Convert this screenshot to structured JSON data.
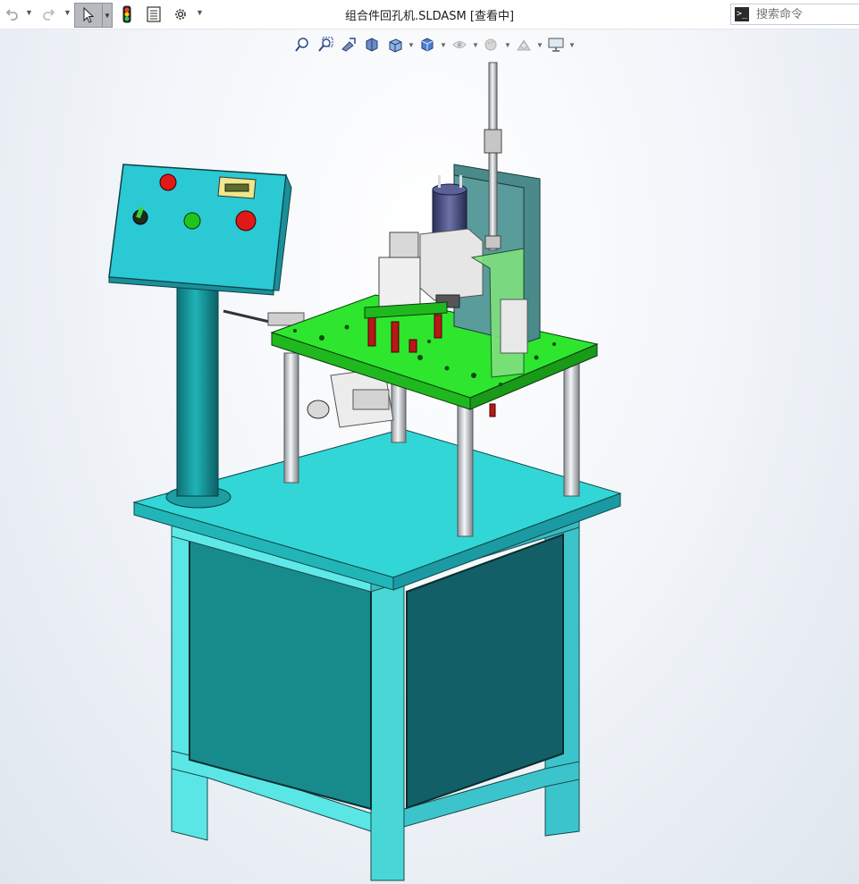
{
  "window": {
    "title": "组合件回孔机.SLDASM [查看中]"
  },
  "toolbar": {
    "items": [
      {
        "name": "undo-icon"
      },
      {
        "name": "redo-icon"
      },
      {
        "name": "select-pointer-icon"
      },
      {
        "name": "rebuild-traffic-light-icon"
      },
      {
        "name": "file-properties-icon"
      },
      {
        "name": "options-gear-icon"
      }
    ]
  },
  "search": {
    "placeholder": "搜索命令",
    "prompt_glyph": ">_"
  },
  "heads_up_toolbar": {
    "items": [
      "zoom-to-fit-icon",
      "zoom-to-area-icon",
      "previous-view-icon",
      "section-view-icon",
      "view-orientation-icon",
      "display-style-icon",
      "hide-show-items-icon",
      "edit-appearance-icon",
      "apply-scene-icon",
      "view-settings-icon"
    ]
  },
  "colors": {
    "frame_cyan": "#33d6d6",
    "panel_teal": "#178b8b",
    "top_plate_green": "#2ee62e",
    "control_box": "#2bc9d4",
    "background": "#eef2f7"
  }
}
